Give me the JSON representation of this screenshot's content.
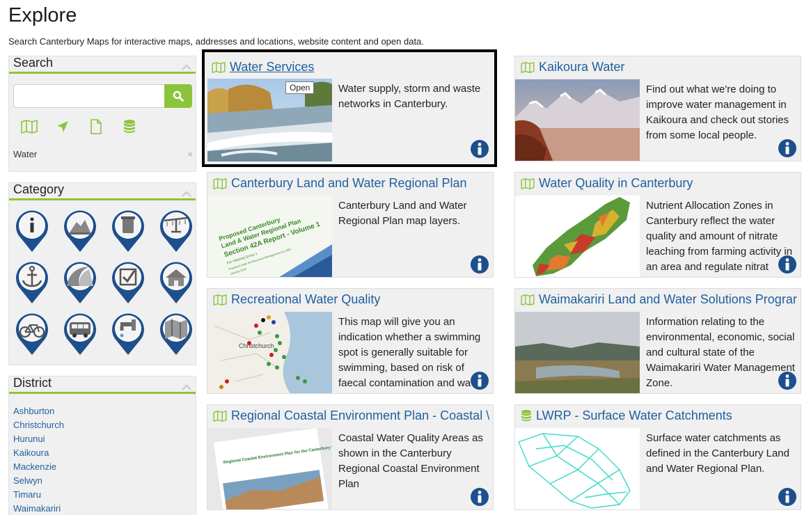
{
  "header": {
    "title": "Explore",
    "subtitle": "Search Canterbury Maps for interactive maps, addresses and locations, website content and open data."
  },
  "search": {
    "title": "Search",
    "input_value": "",
    "active_filter": "Water",
    "clear_symbol": "×"
  },
  "category": {
    "title": "Category",
    "items": [
      "info",
      "hills",
      "tank",
      "irrigation",
      "anchor",
      "wave",
      "checkbox",
      "house",
      "bicycle",
      "bus",
      "tap",
      "map"
    ]
  },
  "district": {
    "title": "District",
    "items": [
      "Ashburton",
      "Christchurch",
      "Hurunui",
      "Kaikoura",
      "Mackenzie",
      "Selwyn",
      "Timaru",
      "Waimakariri"
    ]
  },
  "cards": [
    {
      "title": "Water Services",
      "icon": "map-icon",
      "desc": "Water supply, storm and waste networks in Canterbury.",
      "tooltip": "Open"
    },
    {
      "title": "Kaikoura Water",
      "icon": "map-icon",
      "desc": "Find out what we're doing to improve water management in Kaikoura and check out stories from some local people."
    },
    {
      "title": "Canterbury Land and Water Regional Plan",
      "icon": "map-icon",
      "desc": "Canterbury Land and Water Regional Plan map layers."
    },
    {
      "title": "Water Quality in Canterbury",
      "icon": "map-icon",
      "desc": "Nutrient Allocation Zones in Canterbury reflect the water quality and amount of nitrate leaching from farming activity in an area and regulate nitrat"
    },
    {
      "title": "Recreational Water Quality",
      "icon": "map-icon",
      "desc": "This map will give you an indication whether a swimming spot is generally suitable for swimming, based on risk of faecal contamination and wa"
    },
    {
      "title": "Waimakariri Land and Water Solutions Prograr",
      "icon": "map-icon",
      "desc": "Information relating to the environmental, economic, social and cultural state of the Waimakariri Water Management Zone."
    },
    {
      "title": "Regional Coastal Environment Plan - Coastal \\",
      "icon": "map-icon",
      "desc": "Coastal Water Quality Areas as shown in the Canterbury Regional Coastal Environment Plan"
    },
    {
      "title": "LWRP - Surface Water Catchments",
      "icon": "database-icon",
      "desc": "Surface water catchments as defined in the Canterbury Land and Water Regional Plan."
    }
  ],
  "thumbs": {
    "doc_lines": [
      "Proposed Canterbury",
      "Land & Water Regional Plan",
      "Section 42A Report - Volume 1",
      "For Hearing Group 1",
      "Prepared under the Resource Management Act 1991",
      "January 2015"
    ],
    "map_place": "Christchurch",
    "coastal_doc": "Regional Coastal Environment Plan for the Canterbury Region"
  },
  "colors": {
    "accent": "#8cc43c",
    "link": "#1f5e9e",
    "pin": "#1d4f8c"
  }
}
